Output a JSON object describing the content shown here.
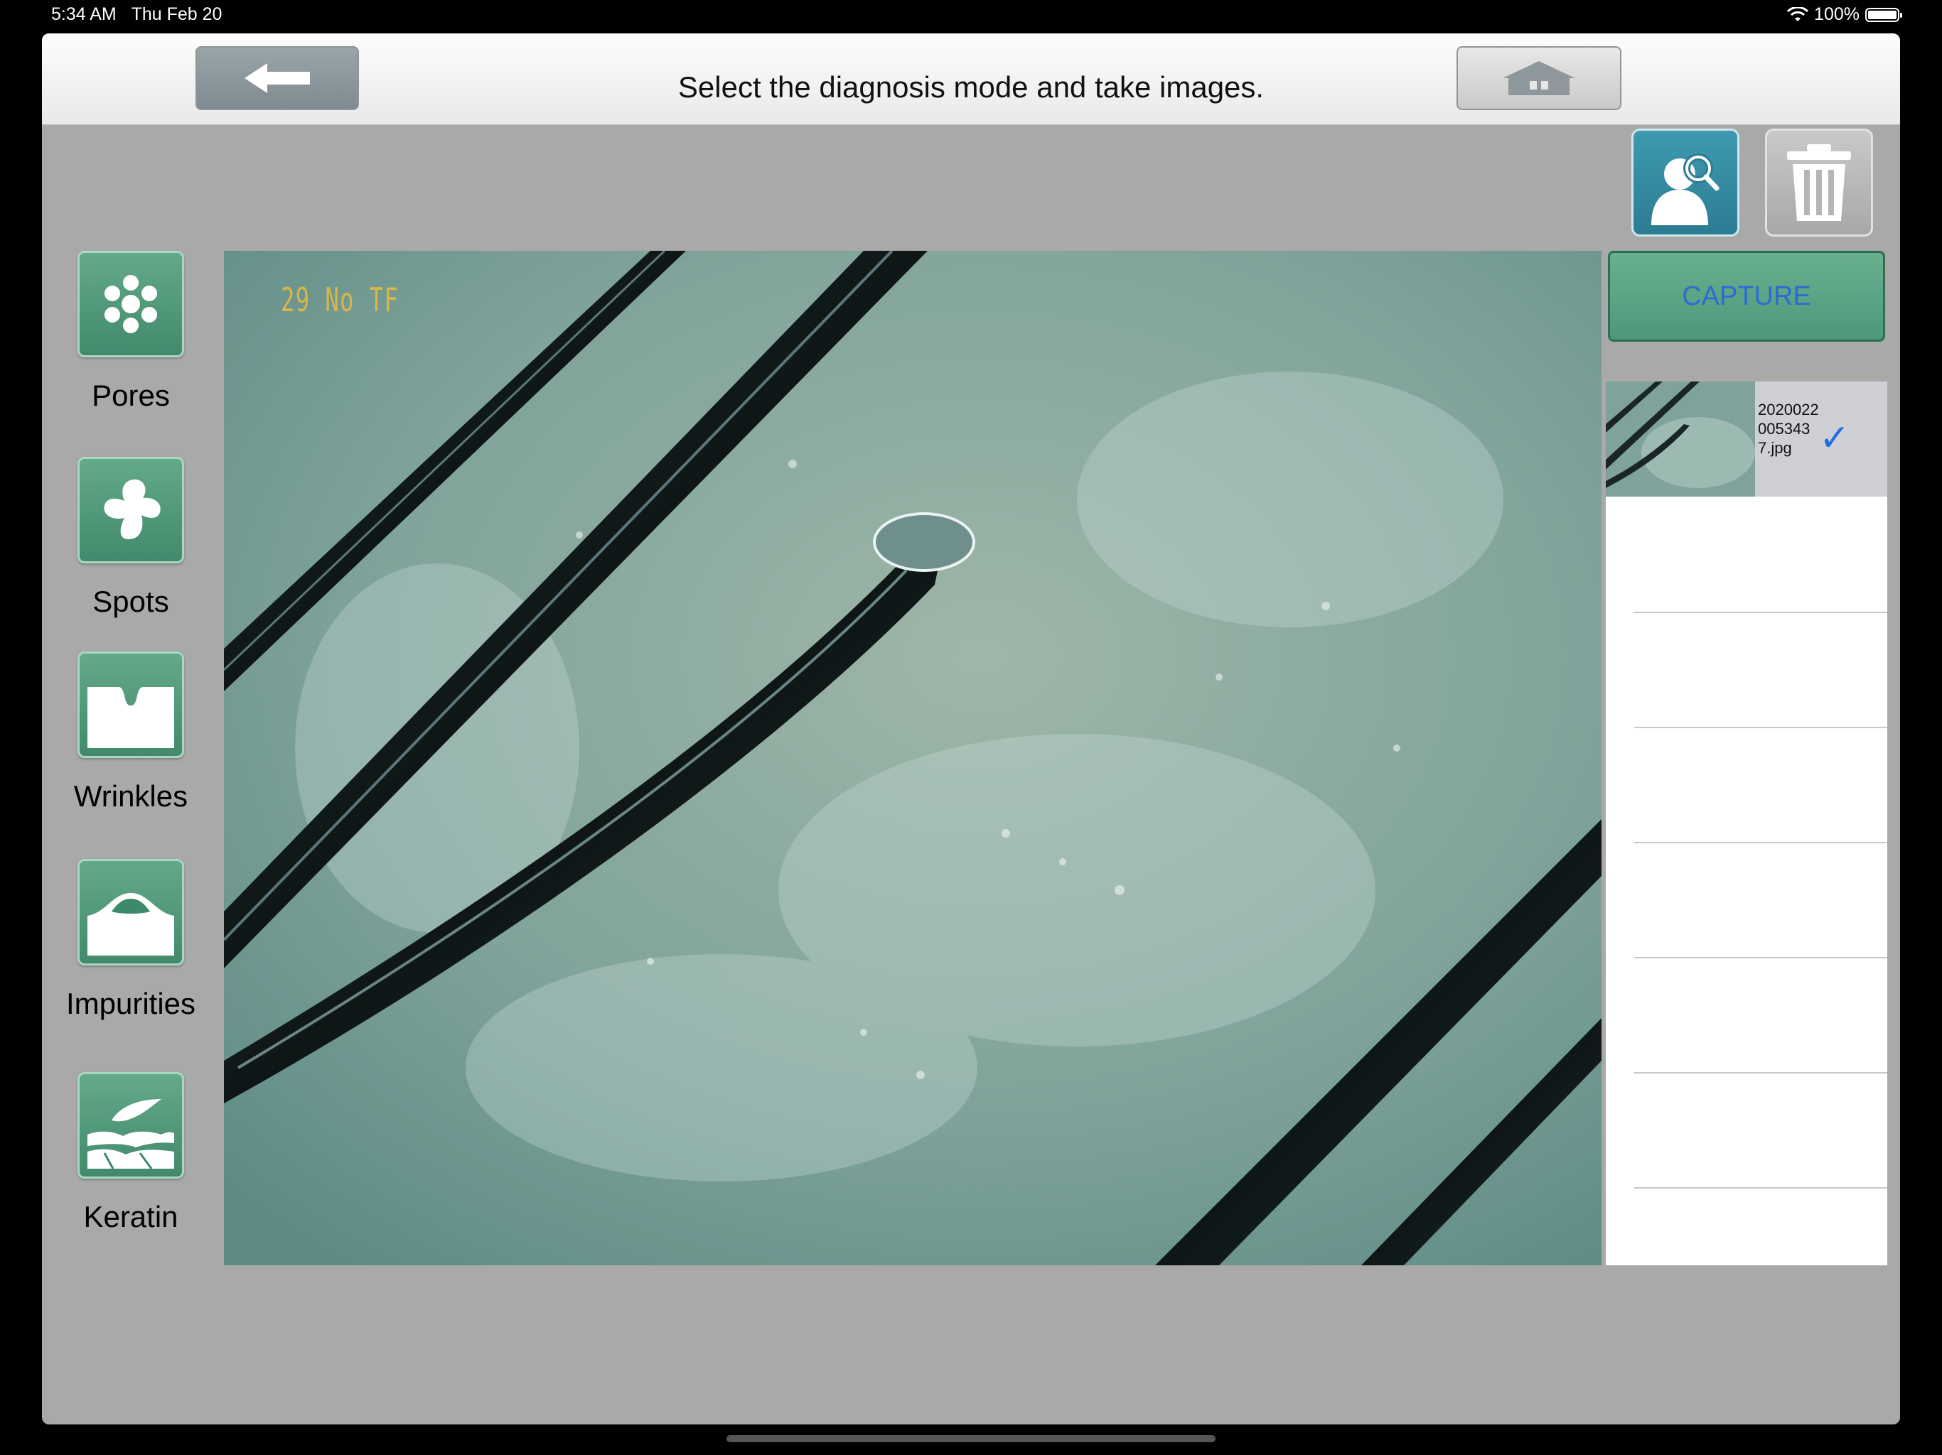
{
  "status_bar": {
    "time": "5:34 AM",
    "date": "Thu Feb 20",
    "battery": "100%",
    "battery_level": 1.0
  },
  "header": {
    "title": "Select the diagnosis mode and take images."
  },
  "modes": [
    {
      "label": "Pores",
      "icon": "pores-icon"
    },
    {
      "label": "Spots",
      "icon": "spots-icon"
    },
    {
      "label": "Wrinkles",
      "icon": "wrinkles-icon"
    },
    {
      "label": "Impurities",
      "icon": "impurities-icon"
    },
    {
      "label": "Keratin",
      "icon": "keratin-icon"
    }
  ],
  "camera": {
    "overlay_text": "29 No TF"
  },
  "capture": {
    "label": "CAPTURE"
  },
  "gallery": {
    "items": [
      {
        "filename": "20200220053437.jpg",
        "selected": true
      }
    ]
  },
  "colors": {
    "accent_green": "#4e987a",
    "capture_text": "#2a6cd6",
    "check_blue": "#1e6fe0"
  }
}
